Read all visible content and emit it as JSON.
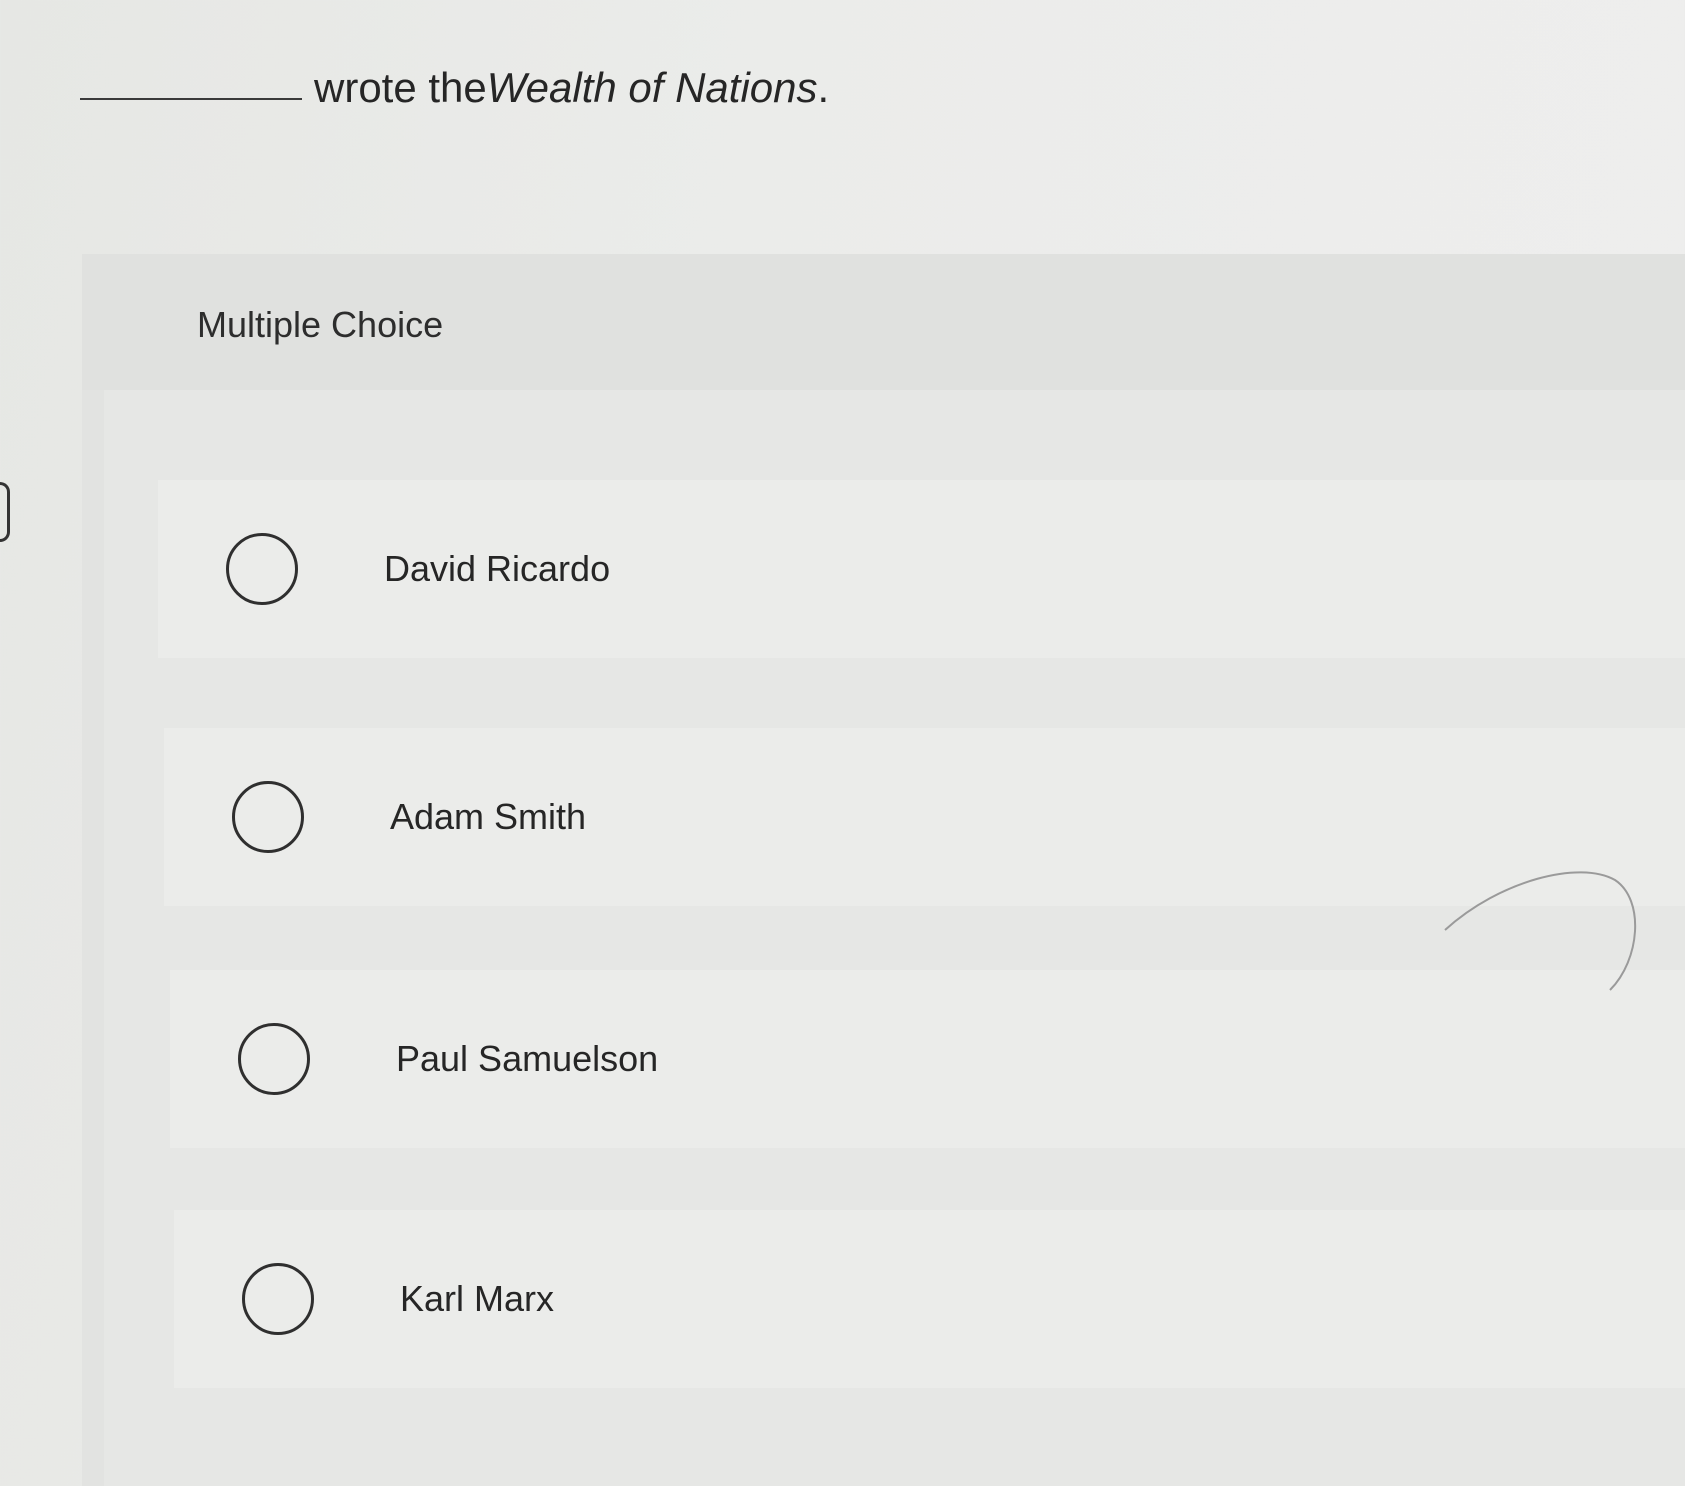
{
  "question": {
    "prefix_text": "wrote the ",
    "italic_title": "Wealth of Nations",
    "suffix": "."
  },
  "panel": {
    "title": "Multiple Choice"
  },
  "options": [
    {
      "label": "David Ricardo",
      "selected": false
    },
    {
      "label": "Adam Smith",
      "selected": false
    },
    {
      "label": "Paul Samuelson",
      "selected": false
    },
    {
      "label": "Karl Marx",
      "selected": false
    }
  ],
  "colors": {
    "text": "#262626",
    "radio_border": "#2f2f2f",
    "background": "#ebecea"
  }
}
